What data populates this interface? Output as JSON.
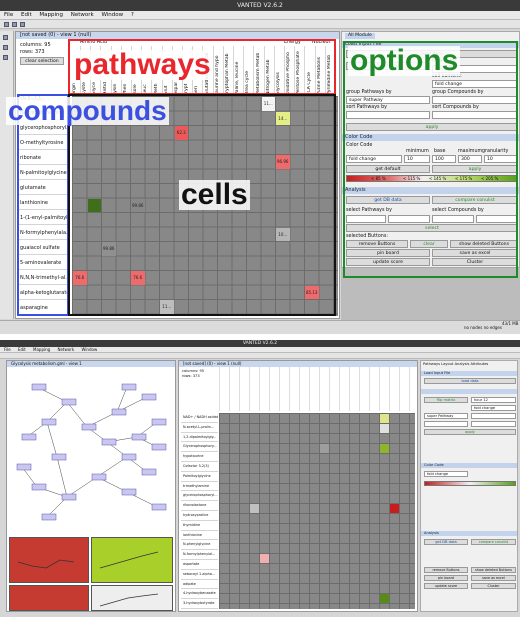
{
  "app_title": "VANTED V2.6.2",
  "menu": [
    "File",
    "Edit",
    "Mapping",
    "Network",
    "Window",
    "?"
  ],
  "matrix_window_title": "[not saved (0) - view 1 (null)",
  "columns_info": "columns: 95",
  "rows_info": "rows: 373",
  "clear_selection_label": "clear selection",
  "group_headers": [
    "Amino Acid",
    "Energy",
    "Nucleot"
  ],
  "column_headers": [
    "Argin",
    "Cyste",
    "Glyce",
    "Histid",
    "Lysin",
    "Phen",
    "Isole",
    "Leuc",
    "Meth",
    "Glut",
    "Aspar",
    "Trypt",
    "Seri",
    "Glutathione Metab",
    "Taurine and hypo",
    "Tryptophan Metab",
    "Valine, leucine",
    "Urea cycle",
    "Metabolism Metab",
    "Nitrogen Metab",
    "Glycolysis",
    "Oxidative Phospho",
    "Pentose Phosphate",
    "TCA Cycle",
    "Purine Metabolis",
    "Pyrimidine Metab"
  ],
  "row_labels": [
    "N-acetylthreonine",
    "glycerophosphoryl...",
    "O-methyltyrosine",
    "ribonate",
    "N-palmitoylglycine",
    "glutamate",
    "lanthionine",
    "1-(1-enyl-palmitoyl...",
    "N-formylphenylala...",
    "guaiacol sulfate",
    "5-aminovalerate",
    "N,N,N-trimethyl-al...",
    "alpha-ketoglutarate",
    "asparagine"
  ],
  "cell_values": [
    "11...",
    "14...",
    "62.3",
    "96.96",
    "99.86",
    "10...",
    "99.86",
    "76.6",
    "76.6",
    "85.13",
    "11..."
  ],
  "row_label_partial": "Palmitoylgly...",
  "options_tab": "All Module",
  "load_input_file": "Load Input File",
  "load_data_button": "load data",
  "flip_matrix_button": "flip matrix",
  "time_point_label": "time Point:",
  "time_point_value": "hour 12",
  "cell_content_label": "cell content:",
  "cell_content_value": "fold change",
  "group_pathways_label": "group Pathways by",
  "group_pathways_value": "super Pathway",
  "group_compounds_label": "group Compounds by",
  "sort_pathways_label": "sort Pathways by",
  "sort_compounds_label": "sort Compounds by",
  "apply_label": "apply",
  "color_code_header": "Color Code",
  "color_code_label": "Color Code",
  "minimum_label": "minimum",
  "base_label": "base",
  "maximum_label": "maximum",
  "granularity_label": "granularity",
  "color_code_value": "fold change",
  "min_value": "10",
  "base_value": "100",
  "max_value": "300",
  "granularity_value": "10",
  "get_default_label": "get default",
  "scale_labels": [
    "< 85 %",
    "< 115 %",
    "< 145 %",
    "< 175 %",
    "< 205 %"
  ],
  "analysis_header": "Analysis",
  "get_db_data_label": "get DB data",
  "compare_label": "compare conulist",
  "select_pathways_label": "select Pathways by",
  "select_compounds_label": "select Compounds by",
  "select_label": "select",
  "selected_buttons_label": "selected Buttons:",
  "remove_buttons_label": "remove Buttons",
  "clear_label": "clear",
  "show_deleted_label": "show deleted Buttons",
  "pin_board_label": "pin board",
  "save_as_excel_label": "save as excel",
  "update_score_label": "update score",
  "cluster_label": "Cluster",
  "status_text": "no nodes   no edges",
  "memory_text": "43/1 MB",
  "callouts": {
    "pathways": "pathways",
    "compounds": "compounds",
    "cells": "cells",
    "options": "options"
  },
  "callout_colors": {
    "pathways": "#e8262c",
    "compounds": "#3b4fe0",
    "cells": "#111111",
    "options": "#1f8a2a"
  },
  "bottom_window_title": "Glycolysis metabolism.gml - view 1",
  "bottom_matrix_title": "[not saved] (0) - view 1 (null)",
  "bottom_columns_info": "columns: 95",
  "bottom_rows_info": "rows: 373",
  "bottom_row_labels": [
    "NAD+ / NADH oxidat...",
    "N-acetyl-L-prolin...",
    "1,2-dipalmitoylgly...",
    "Glycerophosphory...",
    "hypotaurine",
    "Cofactor 3-2(3)",
    "Palmitoylglycine",
    "trimethylamine",
    "glycerophosphoryl...",
    "ribonolactone",
    "hydroxyproline",
    "thymidine",
    "lanthionine",
    "N-phenylglycine",
    "N-formylphenylal...",
    "aspartate",
    "sebacoyl 1-alpha...",
    "adipate",
    "4-hydroxybenzoate",
    "3-hydroxybutyrate"
  ],
  "bottom_tabs": [
    "Pathways",
    "Layout",
    "Analysis",
    "Attributes"
  ],
  "bottom_panel_title": "Load Input File"
}
